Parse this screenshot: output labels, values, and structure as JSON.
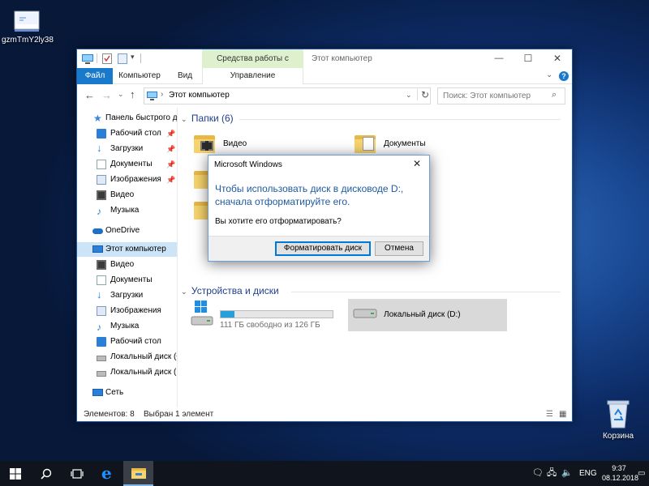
{
  "desktop": {
    "file_icon_label": "gzmTmY2ly38",
    "recycle_bin_label": "Корзина"
  },
  "explorer": {
    "context_header": "Средства работы с дисками",
    "window_title": "Этот компьютер",
    "caption_buttons": {
      "minimize": "—",
      "maximize": "☐",
      "close": "✕"
    },
    "ribbon_tabs": {
      "file": "Файл",
      "computer": "Компьютер",
      "view": "Вид",
      "manage": "Управление"
    },
    "address_path": "Этот компьютер",
    "search_placeholder": "Поиск: Этот компьютер",
    "nav": {
      "quick_access": "Панель быстрого доступа",
      "qa_items": [
        "Рабочий стол",
        "Загрузки",
        "Документы",
        "Изображения",
        "Видео",
        "Музыка"
      ],
      "onedrive": "OneDrive",
      "this_pc": "Этот компьютер",
      "pc_items": [
        "Видео",
        "Документы",
        "Загрузки",
        "Изображения",
        "Музыка",
        "Рабочий стол",
        "Локальный диск (C:)",
        "Локальный диск (D:)"
      ],
      "network": "Сеть"
    },
    "folders_header": "Папки (6)",
    "folders": [
      "Видео",
      "Документы"
    ],
    "devices_header": "Устройства и диски",
    "drive_c": {
      "free_text": "111 ГБ свободно из 126 ГБ",
      "used_fraction": 0.12
    },
    "drive_d": {
      "label": "Локальный диск (D:)"
    },
    "status": {
      "items": "Элементов: 8",
      "selected": "Выбран 1 элемент"
    }
  },
  "dialog": {
    "title": "Microsoft Windows",
    "message": "Чтобы использовать диск в дисководе D:, сначала отформатируйте его.",
    "question": "Вы хотите его отформатировать?",
    "format_button": "Форматировать диск",
    "cancel_button": "Отмена"
  },
  "taskbar": {
    "language": "ENG",
    "time": "9:37",
    "date": "08.12.2018"
  },
  "colors": {
    "accent": "#1979ca",
    "dialog_text": "#1e5aa0",
    "context_tab": "#dff0cf"
  }
}
